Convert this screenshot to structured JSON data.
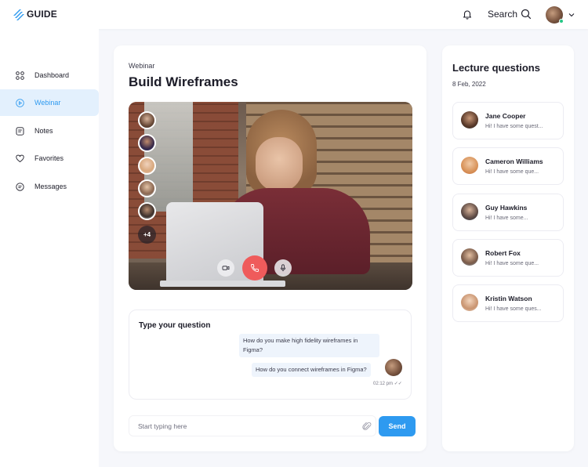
{
  "app": {
    "logo_text": "GUIDE"
  },
  "header": {
    "search_label": "Search"
  },
  "sidebar": {
    "items": [
      {
        "label": "Dashboard",
        "icon": "grid-icon",
        "active": false
      },
      {
        "label": "Webinar",
        "icon": "play-circle-icon",
        "active": true
      },
      {
        "label": "Notes",
        "icon": "notes-icon",
        "active": false
      },
      {
        "label": "Favorites",
        "icon": "heart-icon",
        "active": false
      },
      {
        "label": "Messages",
        "icon": "message-icon",
        "active": false
      }
    ]
  },
  "main": {
    "kicker": "Webinar",
    "title": "Build Wireframes",
    "video": {
      "extra_participants": "+4"
    },
    "chat": {
      "title": "Type your question",
      "messages": [
        {
          "text": "How do you make high fidelity wireframes in Figma?"
        },
        {
          "text": "How do you connect wireframes in Figma?"
        }
      ],
      "time": "02:12 pm"
    },
    "input": {
      "placeholder": "Start typing here"
    },
    "send_label": "Send"
  },
  "side": {
    "title": "Lecture questions",
    "date": "8 Feb, 2022",
    "questions": [
      {
        "name": "Jane Cooper",
        "message": "Hi! I have some quest..."
      },
      {
        "name": "Cameron Williams",
        "message": "Hi! I have some que..."
      },
      {
        "name": "Guy Hawkins",
        "message": "Hi! I have some..."
      },
      {
        "name": "Robert Fox",
        "message": "Hi! I have some que..."
      },
      {
        "name": "Kristin Watson",
        "message": "Hi! I have some ques..."
      }
    ]
  },
  "colors": {
    "accent": "#2e9af0",
    "end_call": "#ef5b5b",
    "active_bg": "#e3f0fd"
  }
}
